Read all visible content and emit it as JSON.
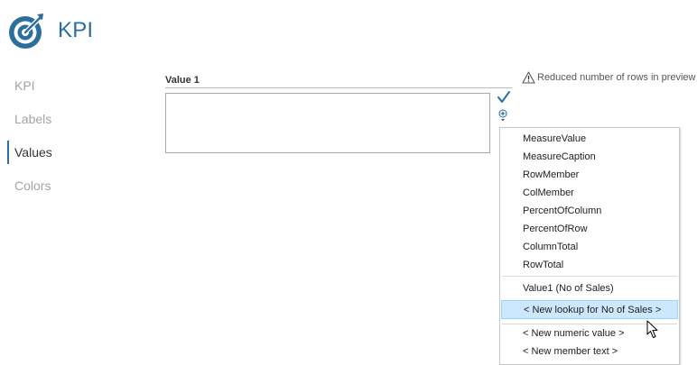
{
  "app": {
    "title": "KPI"
  },
  "sidebar": {
    "items": [
      {
        "label": "KPI",
        "active": false
      },
      {
        "label": "Labels",
        "active": false
      },
      {
        "label": "Values",
        "active": true
      },
      {
        "label": "Colors",
        "active": false
      }
    ]
  },
  "main": {
    "field_label": "Value 1",
    "field_value": "",
    "warning_text": "Reduced number of rows in preview"
  },
  "menu": {
    "group1": [
      "MeasureValue",
      "MeasureCaption",
      "RowMember",
      "ColMember",
      "PercentOfColumn",
      "PercentOfRow",
      "ColumnTotal",
      "RowTotal"
    ],
    "group2": [
      "Value1 (No of Sales)",
      "< New lookup for No of Sales >"
    ],
    "group3": [
      "< New numeric value >",
      "< New member text >"
    ],
    "highlighted": "< New lookup for No of Sales >"
  },
  "colors": {
    "accent": "#2b6f9e",
    "menu_highlight": "#cce8ff",
    "menu_highlight_border": "#99d1ff",
    "check": "#2b6f9e"
  },
  "icons": {
    "logo": "target-arrow-icon",
    "confirm": "checkmark-icon",
    "insert": "plus-circle-dropdown-icon",
    "warning": "warning-triangle-icon",
    "pointer": "mouse-pointer-icon"
  }
}
